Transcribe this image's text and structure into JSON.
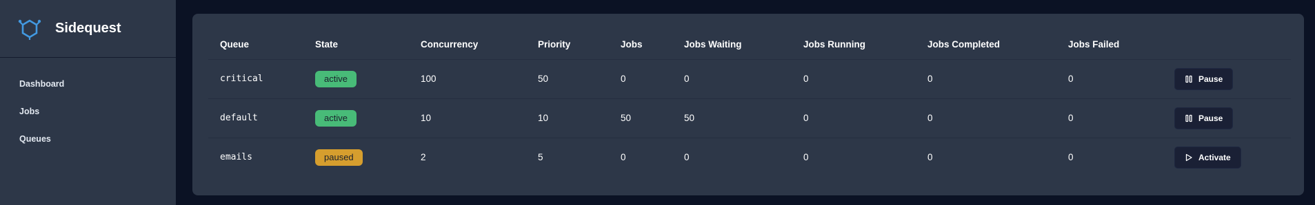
{
  "app": {
    "name": "Sidequest",
    "logo_icon": "hexagon-network-icon",
    "accent": "#4299e1"
  },
  "sidebar": {
    "items": [
      {
        "label": "Dashboard"
      },
      {
        "label": "Jobs"
      },
      {
        "label": "Queues"
      }
    ]
  },
  "table": {
    "headers": [
      "Queue",
      "State",
      "Concurrency",
      "Priority",
      "Jobs",
      "Jobs Waiting",
      "Jobs Running",
      "Jobs Completed",
      "Jobs Failed"
    ],
    "rows": [
      {
        "queue": "critical",
        "state": "active",
        "concurrency": "100",
        "priority": "50",
        "jobs": "0",
        "waiting": "0",
        "running": "0",
        "completed": "0",
        "failed": "0",
        "action": "Pause",
        "action_icon": "pause-icon"
      },
      {
        "queue": "default",
        "state": "active",
        "concurrency": "10",
        "priority": "10",
        "jobs": "50",
        "waiting": "50",
        "running": "0",
        "completed": "0",
        "failed": "0",
        "action": "Pause",
        "action_icon": "pause-icon"
      },
      {
        "queue": "emails",
        "state": "paused",
        "concurrency": "2",
        "priority": "5",
        "jobs": "0",
        "waiting": "0",
        "running": "0",
        "completed": "0",
        "failed": "0",
        "action": "Activate",
        "action_icon": "play-icon"
      }
    ]
  },
  "colors": {
    "active_badge": "#48bb78",
    "paused_badge": "#d69e2e",
    "panel": "#2d3748",
    "background": "#0b1224"
  }
}
